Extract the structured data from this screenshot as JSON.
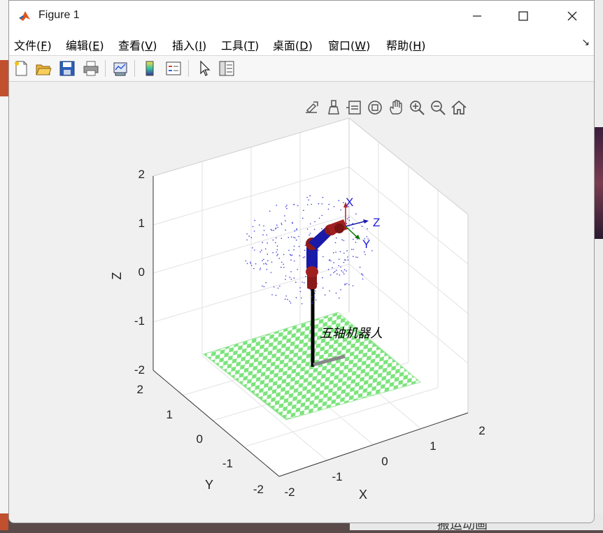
{
  "window": {
    "title": "Figure 1"
  },
  "menu": [
    {
      "text": "文件(",
      "key": "F",
      "tail": ")"
    },
    {
      "text": "编辑(",
      "key": "E",
      "tail": ")"
    },
    {
      "text": "查看(",
      "key": "V",
      "tail": ")"
    },
    {
      "text": "插入(",
      "key": "I",
      "tail": ")"
    },
    {
      "text": "工具(",
      "key": "T",
      "tail": ")"
    },
    {
      "text": "桌面(",
      "key": "D",
      "tail": ")"
    },
    {
      "text": "窗口(",
      "key": "W",
      "tail": ")"
    },
    {
      "text": "帮助(",
      "key": "H",
      "tail": ")"
    }
  ],
  "menu_overflow_icon": "dock-arrow-icon",
  "toolbar_icons": [
    "new-figure-icon",
    "open-file-icon",
    "save-icon",
    "print-icon",
    "link-plot-icon",
    "colorbar-icon",
    "legend-icon",
    "pointer-icon",
    "property-editor-icon"
  ],
  "axes_toolbar_icons": [
    "export-icon",
    "brush-icon",
    "data-tips-icon",
    "rotate-3d-icon",
    "pan-icon",
    "zoom-in-icon",
    "zoom-out-icon",
    "home-icon"
  ],
  "plot": {
    "axis_labels": {
      "x": "X",
      "y": "Y",
      "z": "Z"
    },
    "x_ticks": [
      "-2",
      "-1",
      "0",
      "1",
      "2"
    ],
    "y_ticks": [
      "-2",
      "-1",
      "0",
      "1",
      "2"
    ],
    "z_ticks": [
      "2",
      "1",
      "0",
      "-1",
      "-2"
    ],
    "frame_labels": {
      "x": "X",
      "y": "Y",
      "z": "Z"
    },
    "annotation": "五轴机器人",
    "colors": {
      "floor_light": "#ffffff",
      "floor_dark": "#7ce47c",
      "robot_link": "#1a1aa8",
      "robot_joint": "#8b1a1a",
      "pole": "#000000",
      "point_cloud": "#3a3ad8"
    }
  },
  "background": {
    "bottom_text": "搬运动画"
  }
}
